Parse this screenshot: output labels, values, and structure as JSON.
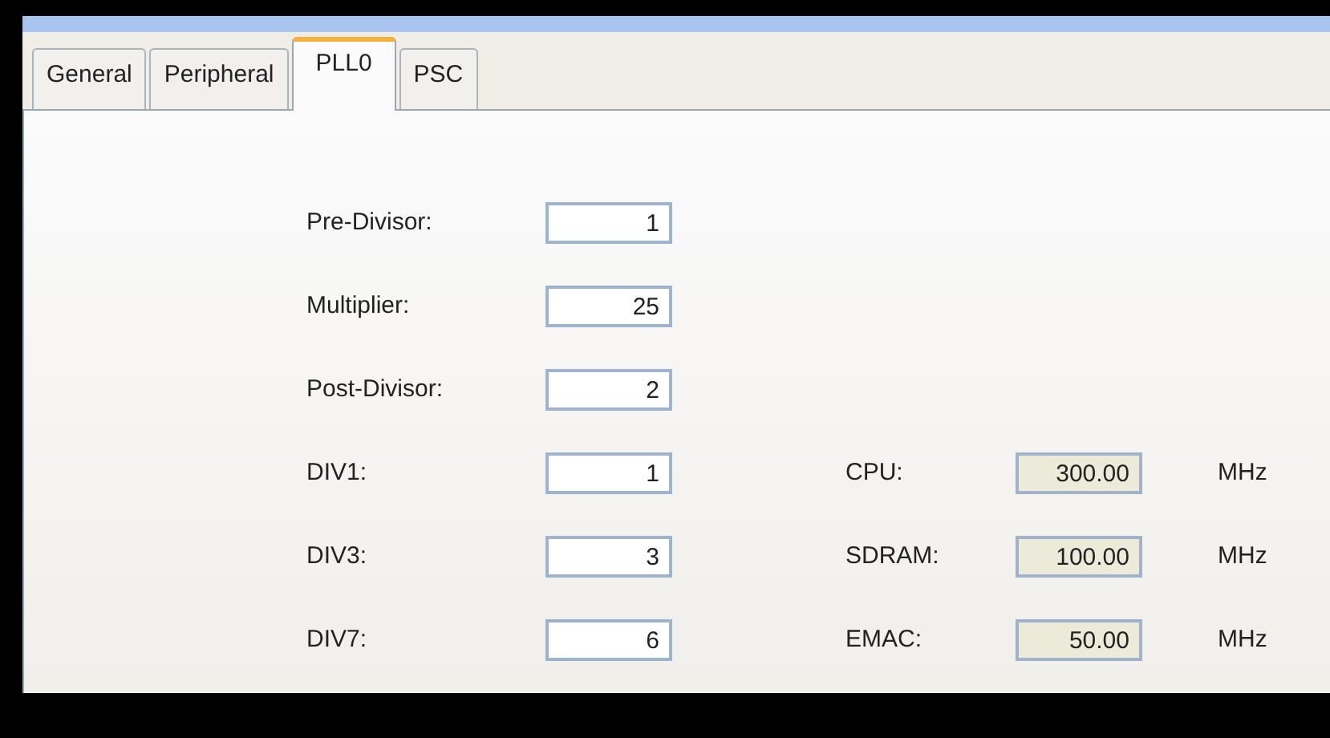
{
  "tabs": [
    {
      "label": "General",
      "selected": false
    },
    {
      "label": "Peripheral",
      "selected": false
    },
    {
      "label": "PLL0",
      "selected": true
    },
    {
      "label": "PSC",
      "selected": false
    }
  ],
  "rows": [
    {
      "label": "Pre-Divisor:",
      "value": "1"
    },
    {
      "label": "Multiplier:",
      "value": "25"
    },
    {
      "label": "Post-Divisor:",
      "value": "2"
    },
    {
      "label": "DIV1:",
      "value": "1",
      "output": {
        "label": "CPU:",
        "value": "300.00",
        "unit": "MHz",
        "readonly": true
      }
    },
    {
      "label": "DIV3:",
      "value": "3",
      "output": {
        "label": "SDRAM:",
        "value": "100.00",
        "unit": "MHz",
        "readonly": true
      }
    },
    {
      "label": "DIV7:",
      "value": "6",
      "output": {
        "label": "EMAC:",
        "value": "50.00",
        "unit": "MHz",
        "readonly": true
      }
    }
  ]
}
